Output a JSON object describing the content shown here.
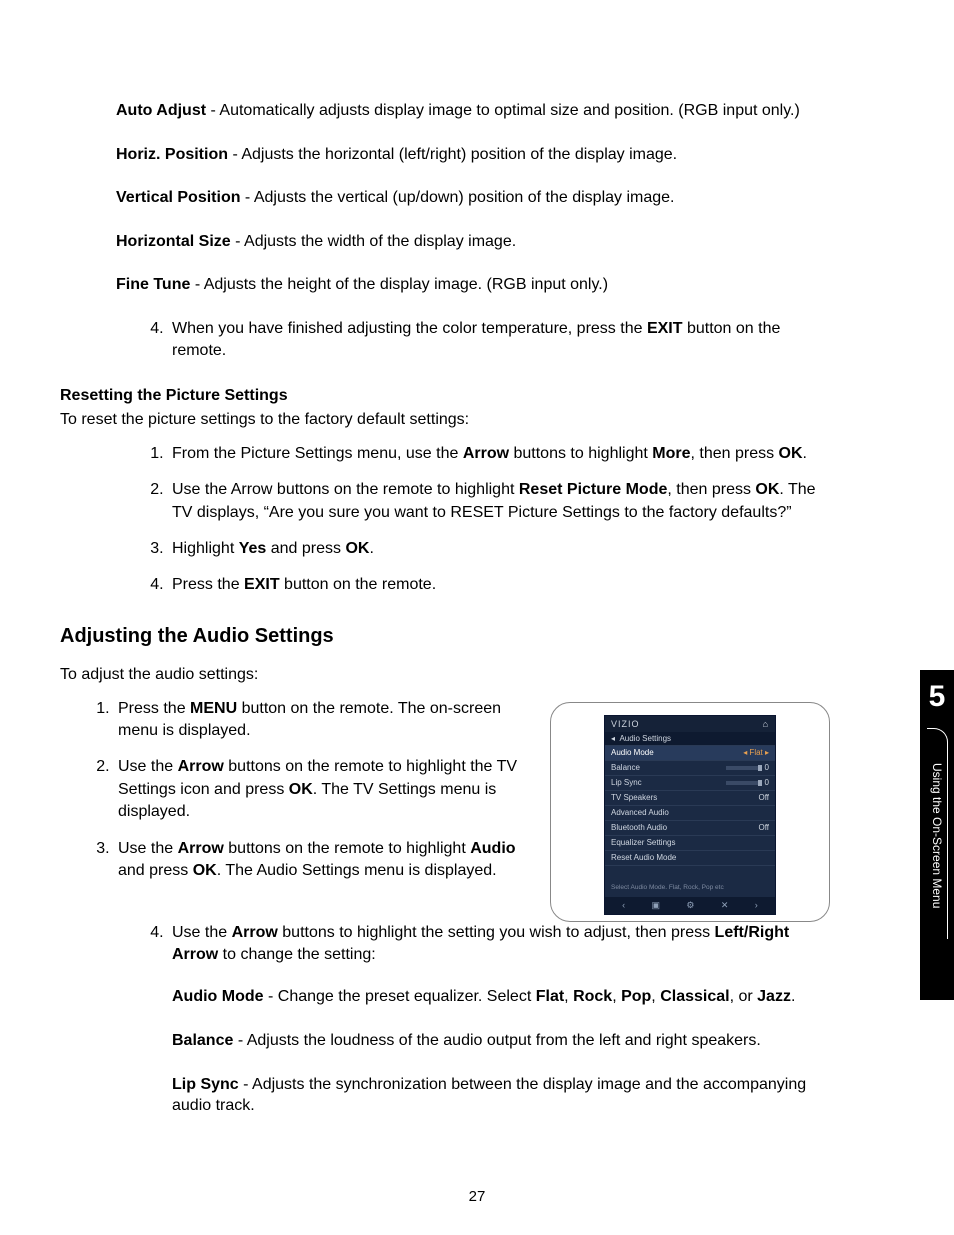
{
  "defs_top": [
    {
      "term": "Auto Adjust",
      "desc": " - Automatically adjusts display image to optimal size and position. (RGB input only.)"
    },
    {
      "term": "Horiz. Position",
      "desc": " - Adjusts the horizontal (left/right) position of the display image."
    },
    {
      "term": "Vertical Position",
      "desc": " - Adjusts the vertical (up/down) position of the display image."
    },
    {
      "term": "Horizontal Size",
      "desc": " - Adjusts the width of the display image."
    },
    {
      "term": "Fine Tune",
      "desc": " - Adjusts the height of the display image. (RGB input only.)"
    }
  ],
  "step4_top": {
    "pre": "When you have finished adjusting the color temperature, press the ",
    "bold": "EXIT",
    "post": " button on the remote."
  },
  "reset_heading": "Resetting the Picture Settings",
  "reset_intro": "To reset the picture settings to the factory default settings:",
  "reset_steps": {
    "s1": {
      "t1": "From the Picture Settings menu, use the ",
      "b1": "Arrow",
      "t2": " buttons to highlight ",
      "b2": "More",
      "t3": ", then press ",
      "b3": "OK",
      "t4": "."
    },
    "s2": {
      "t1": "Use the Arrow buttons on the remote to highlight ",
      "b1": "Reset Picture Mode",
      "t2": ", then press ",
      "b2": "OK",
      "t3": ". The TV displays, “Are you sure you want to RESET Picture Settings to the factory defaults?”"
    },
    "s3": {
      "t1": "Highlight ",
      "b1": "Yes",
      "t2": " and press ",
      "b2": "OK",
      "t3": "."
    },
    "s4": {
      "t1": "Press the ",
      "b1": "EXIT",
      "t2": " button on the remote."
    }
  },
  "audio_heading": "Adjusting the Audio Settings",
  "audio_intro": "To adjust the audio settings:",
  "audio_steps": {
    "s1": {
      "t1": "Press the ",
      "b1": "MENU",
      "t2": " button on the remote. The on-screen menu is displayed."
    },
    "s2": {
      "t1": "Use the ",
      "b1": "Arrow",
      "t2": " buttons on the remote to highlight the TV Settings icon and press ",
      "b2": "OK",
      "t3": ". The TV Settings menu is displayed."
    },
    "s3": {
      "t1": "Use the ",
      "b1": "Arrow",
      "t2": " buttons on the remote to highlight ",
      "b2": "Audio",
      "t3": " and press ",
      "b3": "OK",
      "t4": ". The Audio Settings menu is displayed."
    },
    "s4": {
      "t1": "Use the ",
      "b1": "Arrow",
      "t2": " buttons to highlight the setting you wish to adjust, then press ",
      "b2": "Left/Right Arrow",
      "t3": " to change the setting:"
    }
  },
  "audio_defs": [
    {
      "term": "Audio Mode",
      "pre": " - Change the preset equalizer. Select ",
      "opts": [
        "Flat",
        "Rock",
        "Pop",
        "Classical",
        "Jazz"
      ]
    },
    {
      "term": "Balance",
      "desc": " - Adjusts the loudness of the audio output from the left and right speakers."
    },
    {
      "term": "Lip Sync",
      "desc": " - Adjusts the synchronization between the display image and the accompanying audio track."
    }
  ],
  "osd": {
    "brand": "VIZIO",
    "title": "Audio Settings",
    "rows": [
      {
        "label": "Audio Mode",
        "value": "Flat",
        "hl": true,
        "arrows": true
      },
      {
        "label": "Balance",
        "slider": true,
        "value": "0"
      },
      {
        "label": "Lip Sync",
        "slider": true,
        "value": "0"
      },
      {
        "label": "TV Speakers",
        "value": "Off"
      },
      {
        "label": "Advanced Audio"
      },
      {
        "label": "Bluetooth Audio",
        "value": "Off"
      },
      {
        "label": "Equalizer Settings"
      },
      {
        "label": "Reset Audio Mode"
      }
    ],
    "hint": "Select Audio Mode. Flat, Rock, Pop etc",
    "footer_icons": [
      "‹",
      "▣",
      "⚙",
      "✕",
      "›"
    ]
  },
  "sidebar": {
    "chapter": "5",
    "label": "Using the On-Screen Menu"
  },
  "page_number": "27"
}
